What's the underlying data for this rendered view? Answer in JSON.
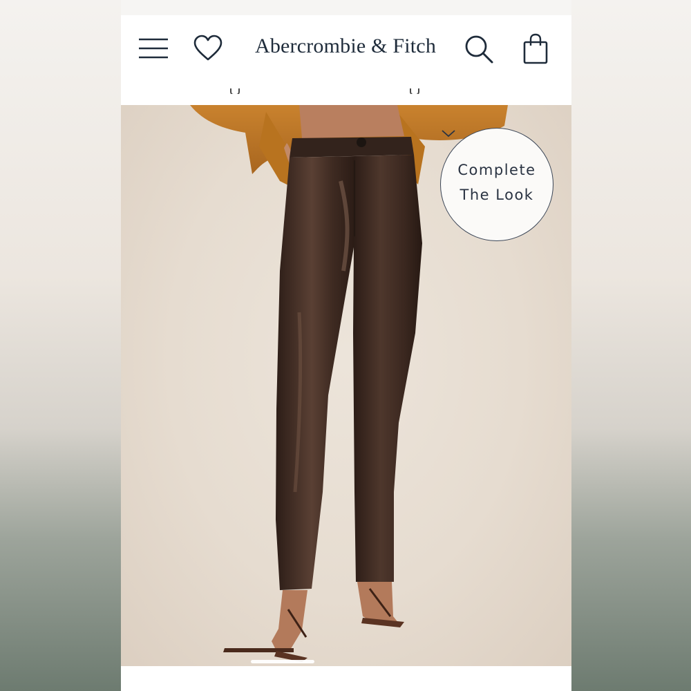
{
  "header": {
    "brand": "Abercrombie & Fitch",
    "icons": [
      "menu-icon",
      "heart-icon",
      "search-icon",
      "shopping-bag-icon"
    ]
  },
  "overlay": {
    "line1": "Complete",
    "line2": "The Look",
    "icon": "chevron-down-icon"
  },
  "product": {
    "image": "brown vegan leather straight-leg pants with orange sweater and strappy sandals"
  },
  "colors": {
    "brand_text": "#1e2b3a",
    "pants": "#3e2a22",
    "sweater": "#c17a2a",
    "background": "#e6dcd0"
  }
}
